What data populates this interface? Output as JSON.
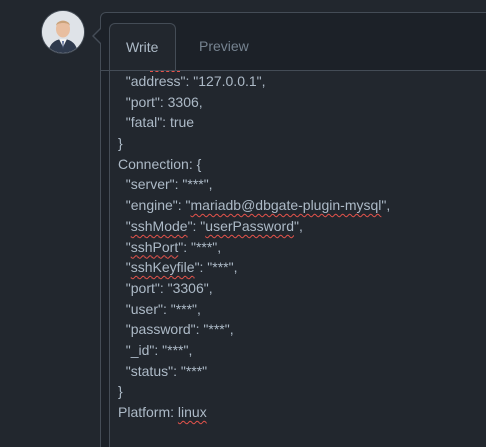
{
  "tabs": {
    "write": "Write",
    "preview": "Preview"
  },
  "colors": {
    "background": "#22272e",
    "text": "#adbac7",
    "muted": "#768390",
    "border": "#444c56",
    "spellcheck": "#e5534b"
  },
  "editor": {
    "lines": [
      {
        "before": "  \"address\": \"127.0.0.1\",",
        "word": "",
        "after": ""
      },
      {
        "before": "  \"port\": 3306,",
        "word": "",
        "after": ""
      },
      {
        "before": "  \"fatal\": true",
        "word": "",
        "after": ""
      },
      {
        "before": "}",
        "word": "",
        "after": ""
      },
      {
        "before": "Connection: {",
        "word": "",
        "after": ""
      },
      {
        "before": "  \"server\": \"***\",",
        "word": "",
        "after": ""
      },
      {
        "before": "  \"engine\": \"",
        "word": "mariadb@dbgate-plugin-mysql",
        "after": "\","
      },
      {
        "before": "  \"",
        "word": "sshMode",
        "after": "\": \"",
        "word2": "userPassword",
        "after2": "\","
      },
      {
        "before": "  \"",
        "word": "sshPort",
        "after": "\": \"***\","
      },
      {
        "before": "  \"",
        "word": "sshKeyfile",
        "after": "\": \"***\","
      },
      {
        "before": "  \"port\": \"3306\",",
        "word": "",
        "after": ""
      },
      {
        "before": "  \"user\": \"***\",",
        "word": "",
        "after": ""
      },
      {
        "before": "  \"password\": \"***\",",
        "word": "",
        "after": ""
      },
      {
        "before": "  \"_id\": \"***\",",
        "word": "",
        "after": ""
      },
      {
        "before": "  \"status\": \"***\"",
        "word": "",
        "after": ""
      },
      {
        "before": "}",
        "word": "",
        "after": ""
      },
      {
        "before": "Platform: ",
        "word": "linux",
        "after": ""
      }
    ]
  },
  "icons": {
    "avatar": "user-avatar-photo"
  }
}
